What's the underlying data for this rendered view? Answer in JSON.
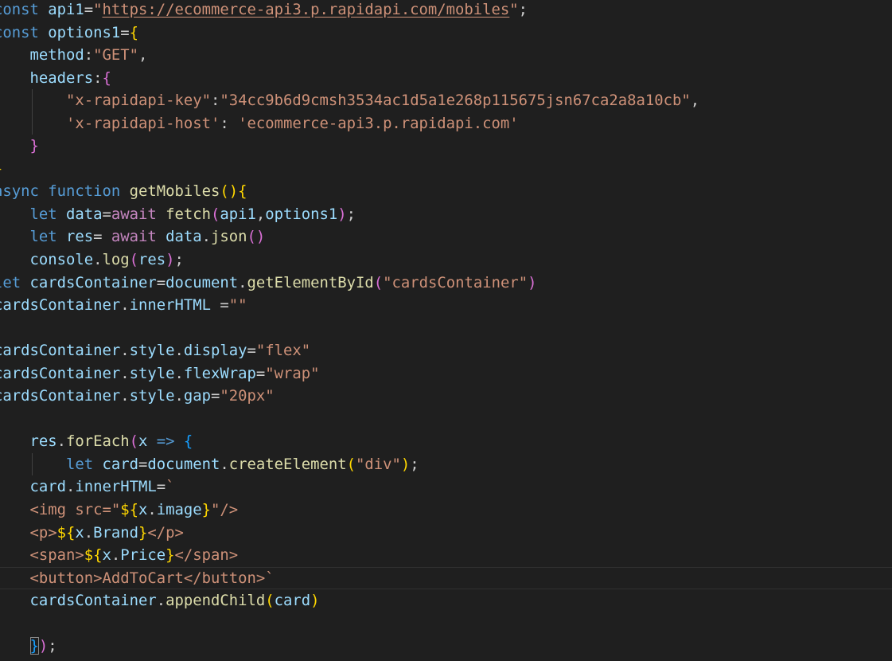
{
  "editor": {
    "theme": {
      "background": "#1f1f1f",
      "keyword": "#569cd6",
      "control": "#c586c0",
      "variable": "#9cdcfe",
      "function": "#dcdcaa",
      "string": "#ce9178",
      "plain": "#cccccc",
      "tag": "#808080",
      "bracket1": "#ffd700",
      "bracket2": "#da70d6",
      "bracket3": "#179fff"
    },
    "lines": [
      {
        "indent": 0,
        "guides": [],
        "tokens": [
          [
            "const",
            "keyword"
          ],
          [
            " ",
            "plain"
          ],
          [
            "api1",
            "variable"
          ],
          [
            "=",
            "plain"
          ],
          [
            "\"",
            "string"
          ],
          [
            "https://ecommerce-api3.p.rapidapi.com/mobiles",
            "url"
          ],
          [
            "\"",
            "string"
          ],
          [
            ";",
            "plain"
          ]
        ]
      },
      {
        "indent": 0,
        "guides": [],
        "tokens": [
          [
            "const",
            "keyword"
          ],
          [
            " ",
            "plain"
          ],
          [
            "options1",
            "variable"
          ],
          [
            "=",
            "plain"
          ],
          [
            "{",
            "bracket1"
          ]
        ]
      },
      {
        "indent": 4,
        "guides": [],
        "tokens": [
          [
            "method",
            "variable"
          ],
          [
            ":",
            "plain"
          ],
          [
            "\"GET\"",
            "string"
          ],
          [
            ",",
            "plain"
          ]
        ]
      },
      {
        "indent": 4,
        "guides": [],
        "tokens": [
          [
            "headers",
            "variable"
          ],
          [
            ":",
            "plain"
          ],
          [
            "{",
            "bracket2"
          ]
        ]
      },
      {
        "indent": 8,
        "guides": [
          4
        ],
        "tokens": [
          [
            "\"x-rapidapi-key\"",
            "string"
          ],
          [
            ":",
            "plain"
          ],
          [
            "\"34cc9b6d9cmsh3534ac1d5a1e268p115675jsn67ca2a8a10cb\"",
            "string"
          ],
          [
            ",",
            "plain"
          ]
        ]
      },
      {
        "indent": 8,
        "guides": [
          4
        ],
        "tokens": [
          [
            "'x-rapidapi-host'",
            "string"
          ],
          [
            ": ",
            "plain"
          ],
          [
            "'ecommerce-api3.p.rapidapi.com'",
            "string"
          ]
        ]
      },
      {
        "indent": 4,
        "guides": [],
        "tokens": [
          [
            "}",
            "bracket2"
          ]
        ]
      },
      {
        "indent": 0,
        "guides": [],
        "tokens": [
          [
            "}",
            "bracket1"
          ]
        ]
      },
      {
        "indent": 0,
        "guides": [],
        "tokens": [
          [
            "async",
            "keyword"
          ],
          [
            " ",
            "plain"
          ],
          [
            "function",
            "keyword"
          ],
          [
            " ",
            "plain"
          ],
          [
            "getMobiles",
            "function"
          ],
          [
            "(",
            "bracket1"
          ],
          [
            ")",
            "bracket1"
          ],
          [
            "{",
            "bracket1"
          ]
        ]
      },
      {
        "indent": 4,
        "guides": [],
        "tokens": [
          [
            "let",
            "keyword"
          ],
          [
            " ",
            "plain"
          ],
          [
            "data",
            "variable"
          ],
          [
            "=",
            "plain"
          ],
          [
            "await",
            "control"
          ],
          [
            " ",
            "plain"
          ],
          [
            "fetch",
            "function"
          ],
          [
            "(",
            "bracket2"
          ],
          [
            "api1",
            "variable"
          ],
          [
            ",",
            "plain"
          ],
          [
            "options1",
            "variable"
          ],
          [
            ")",
            "bracket2"
          ],
          [
            ";",
            "plain"
          ]
        ]
      },
      {
        "indent": 4,
        "guides": [],
        "tokens": [
          [
            "let",
            "keyword"
          ],
          [
            " ",
            "plain"
          ],
          [
            "res",
            "variable"
          ],
          [
            "= ",
            "plain"
          ],
          [
            "await",
            "control"
          ],
          [
            " ",
            "plain"
          ],
          [
            "data",
            "variable"
          ],
          [
            ".",
            "plain"
          ],
          [
            "json",
            "function"
          ],
          [
            "(",
            "bracket2"
          ],
          [
            ")",
            "bracket2"
          ]
        ]
      },
      {
        "indent": 4,
        "guides": [],
        "tokens": [
          [
            "console",
            "variable"
          ],
          [
            ".",
            "plain"
          ],
          [
            "log",
            "function"
          ],
          [
            "(",
            "bracket2"
          ],
          [
            "res",
            "variable"
          ],
          [
            ")",
            "bracket2"
          ],
          [
            ";",
            "plain"
          ]
        ]
      },
      {
        "indent": 0,
        "guides": [],
        "tokens": [
          [
            "let",
            "keyword"
          ],
          [
            " ",
            "plain"
          ],
          [
            "cardsContainer",
            "variable"
          ],
          [
            "=",
            "plain"
          ],
          [
            "document",
            "variable"
          ],
          [
            ".",
            "plain"
          ],
          [
            "getElementById",
            "function"
          ],
          [
            "(",
            "bracket2"
          ],
          [
            "\"cardsContainer\"",
            "string"
          ],
          [
            ")",
            "bracket2"
          ]
        ]
      },
      {
        "indent": 0,
        "guides": [],
        "tokens": [
          [
            "cardsContainer",
            "variable"
          ],
          [
            ".",
            "plain"
          ],
          [
            "innerHTML",
            "variable"
          ],
          [
            " =",
            "plain"
          ],
          [
            "\"\"",
            "string"
          ]
        ]
      },
      {
        "indent": 0,
        "guides": [],
        "tokens": []
      },
      {
        "indent": 0,
        "guides": [],
        "tokens": [
          [
            "cardsContainer",
            "variable"
          ],
          [
            ".",
            "plain"
          ],
          [
            "style",
            "variable"
          ],
          [
            ".",
            "plain"
          ],
          [
            "display",
            "variable"
          ],
          [
            "=",
            "plain"
          ],
          [
            "\"flex\"",
            "string"
          ]
        ]
      },
      {
        "indent": 0,
        "guides": [],
        "tokens": [
          [
            "cardsContainer",
            "variable"
          ],
          [
            ".",
            "plain"
          ],
          [
            "style",
            "variable"
          ],
          [
            ".",
            "plain"
          ],
          [
            "flexWrap",
            "variable"
          ],
          [
            "=",
            "plain"
          ],
          [
            "\"wrap\"",
            "string"
          ]
        ]
      },
      {
        "indent": 0,
        "guides": [],
        "tokens": [
          [
            "cardsContainer",
            "variable"
          ],
          [
            ".",
            "plain"
          ],
          [
            "style",
            "variable"
          ],
          [
            ".",
            "plain"
          ],
          [
            "gap",
            "variable"
          ],
          [
            "=",
            "plain"
          ],
          [
            "\"20px\"",
            "string"
          ]
        ]
      },
      {
        "indent": 0,
        "guides": [],
        "tokens": []
      },
      {
        "indent": 4,
        "guides": [],
        "tokens": [
          [
            "res",
            "variable"
          ],
          [
            ".",
            "plain"
          ],
          [
            "forEach",
            "function"
          ],
          [
            "(",
            "bracket2"
          ],
          [
            "x",
            "variable"
          ],
          [
            " ",
            "plain"
          ],
          [
            "=>",
            "keyword"
          ],
          [
            " ",
            "plain"
          ],
          [
            "{",
            "bracket3"
          ]
        ]
      },
      {
        "indent": 8,
        "guides": [
          4
        ],
        "tokens": [
          [
            "let",
            "keyword"
          ],
          [
            " ",
            "plain"
          ],
          [
            "card",
            "variable"
          ],
          [
            "=",
            "plain"
          ],
          [
            "document",
            "variable"
          ],
          [
            ".",
            "plain"
          ],
          [
            "createElement",
            "function"
          ],
          [
            "(",
            "bracket1"
          ],
          [
            "\"div\"",
            "string"
          ],
          [
            ")",
            "bracket1"
          ],
          [
            ";",
            "plain"
          ]
        ]
      },
      {
        "indent": 4,
        "guides": [],
        "tokens": [
          [
            "card",
            "variable"
          ],
          [
            ".",
            "plain"
          ],
          [
            "innerHTML",
            "variable"
          ],
          [
            "=",
            "plain"
          ],
          [
            "`",
            "string"
          ]
        ]
      },
      {
        "indent": 4,
        "guides": [],
        "tokens": [
          [
            "<img src=\"",
            "string"
          ],
          [
            "${",
            "bracket1"
          ],
          [
            "x",
            "variable"
          ],
          [
            ".",
            "plain"
          ],
          [
            "image",
            "variable"
          ],
          [
            "}",
            "bracket1"
          ],
          [
            "\"/>",
            "string"
          ]
        ]
      },
      {
        "indent": 4,
        "guides": [],
        "tokens": [
          [
            "<p>",
            "string"
          ],
          [
            "${",
            "bracket1"
          ],
          [
            "x",
            "variable"
          ],
          [
            ".",
            "plain"
          ],
          [
            "Brand",
            "variable"
          ],
          [
            "}",
            "bracket1"
          ],
          [
            "</p>",
            "string"
          ]
        ]
      },
      {
        "indent": 4,
        "guides": [],
        "tokens": [
          [
            "<span>",
            "string"
          ],
          [
            "${",
            "bracket1"
          ],
          [
            "x",
            "variable"
          ],
          [
            ".",
            "plain"
          ],
          [
            "Price",
            "variable"
          ],
          [
            "}",
            "bracket1"
          ],
          [
            "</span>",
            "string"
          ]
        ]
      },
      {
        "indent": 4,
        "guides": [],
        "current": true,
        "tokens": [
          [
            "<button>AddToCart</button>`",
            "string"
          ]
        ]
      },
      {
        "indent": 4,
        "guides": [],
        "tokens": [
          [
            "cardsContainer",
            "variable"
          ],
          [
            ".",
            "plain"
          ],
          [
            "appendChild",
            "function"
          ],
          [
            "(",
            "bracket1"
          ],
          [
            "card",
            "variable"
          ],
          [
            ")",
            "bracket1"
          ]
        ]
      },
      {
        "indent": 0,
        "guides": [],
        "tokens": []
      },
      {
        "indent": 4,
        "guides": [],
        "tokens": [
          [
            "}",
            "bracket3-box"
          ],
          [
            ")",
            "bracket2"
          ],
          [
            ";",
            "plain"
          ]
        ]
      }
    ]
  }
}
